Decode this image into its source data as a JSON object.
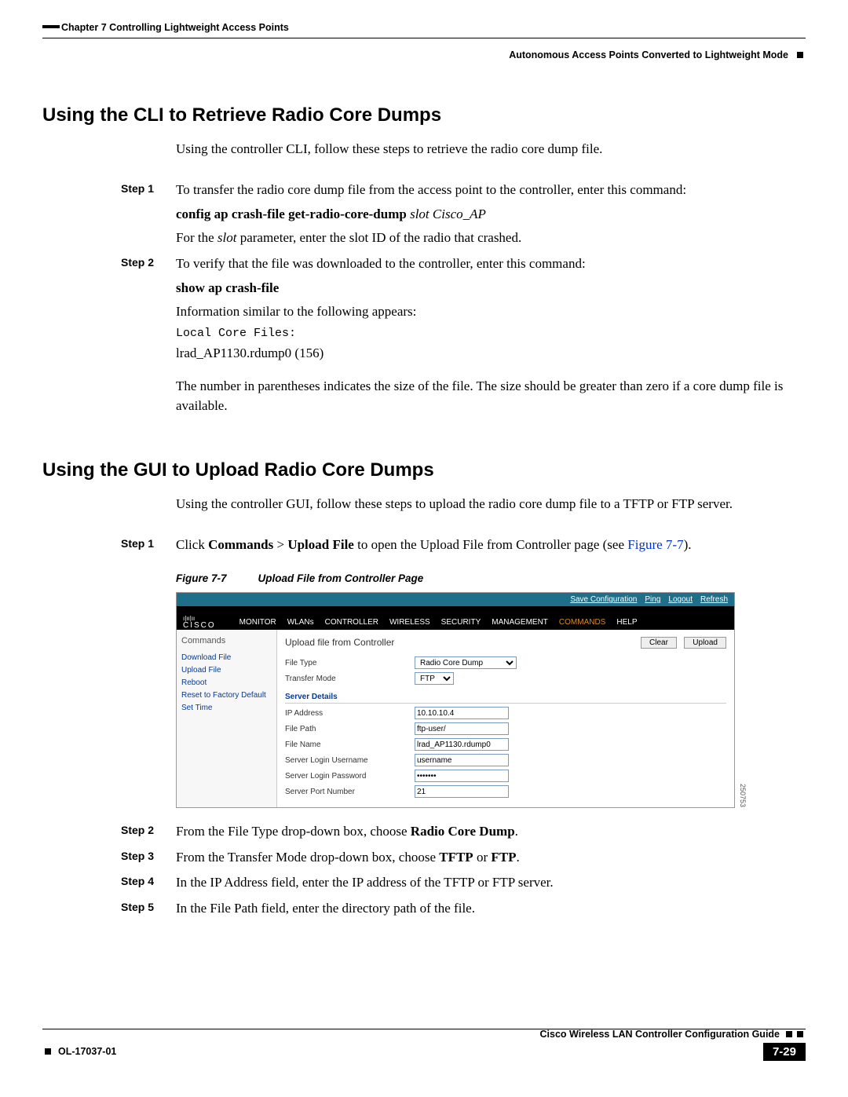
{
  "header": {
    "chapter_left": "Chapter 7    Controlling Lightweight Access Points",
    "right_sub": "Autonomous Access Points Converted to Lightweight Mode"
  },
  "section1": {
    "title": "Using the CLI to Retrieve Radio Core Dumps",
    "intro": "Using the controller CLI, follow these steps to retrieve the radio core dump file.",
    "step1_label": "Step 1",
    "step1_text": "To transfer the radio core dump file from the access point to the controller, enter this command:",
    "step1_cmd_bold": "config ap crash-file get-radio-core-dump ",
    "step1_cmd_ital": "slot Cisco_AP",
    "step1_text2a": "For the ",
    "step1_text2_ital": "slot",
    "step1_text2b": " parameter, enter the slot ID of the radio that crashed.",
    "step2_label": "Step 2",
    "step2_text": "To verify that the file was downloaded to the controller, enter this command:",
    "step2_cmd": "show ap crash-file",
    "step2_info": "Information similar to the following appears:",
    "step2_mono": "Local Core Files:",
    "step2_line": "lrad_AP1130.rdump0   (156)",
    "step2_note": "The number in parentheses indicates the size of the file. The size should be greater than zero if a core dump file is available."
  },
  "section2": {
    "title": "Using the GUI to Upload Radio Core Dumps",
    "intro": "Using the controller GUI, follow these steps to upload the radio core dump file to a TFTP or FTP server.",
    "step1_label": "Step 1",
    "step1_a": "Click ",
    "step1_b": "Commands",
    "step1_c": " > ",
    "step1_d": "Upload File",
    "step1_e": " to open the Upload File from Controller page (see ",
    "step1_link": "Figure 7-7",
    "step1_f": ").",
    "fig_num": "Figure 7-7",
    "fig_title": "Upload File from Controller Page",
    "step2_label": "Step 2",
    "step2_a": "From the File Type drop-down box, choose ",
    "step2_b": "Radio Core Dump",
    "step2_c": ".",
    "step3_label": "Step 3",
    "step3_a": "From the Transfer Mode drop-down box, choose ",
    "step3_b": "TFTP",
    "step3_c": " or ",
    "step3_d": "FTP",
    "step3_e": ".",
    "step4_label": "Step 4",
    "step4_text": "In the IP Address field, enter the IP address of the TFTP or FTP server.",
    "step5_label": "Step 5",
    "step5_text": "In the File Path field, enter the directory path of the file."
  },
  "screenshot": {
    "toplinks": [
      "Save Configuration",
      "Ping",
      "Logout",
      "Refresh"
    ],
    "logo": "CISCO",
    "nav": [
      "MONITOR",
      "WLANs",
      "CONTROLLER",
      "WIRELESS",
      "SECURITY",
      "MANAGEMENT",
      "COMMANDS",
      "HELP"
    ],
    "nav_active_index": 6,
    "side_title": "Commands",
    "side_links": [
      "Download File",
      "Upload File",
      "Reboot",
      "Reset to Factory Default",
      "Set Time"
    ],
    "main_title": "Upload file from Controller",
    "btn_clear": "Clear",
    "btn_upload": "Upload",
    "file_type_label": "File Type",
    "file_type_value": "Radio Core Dump",
    "transfer_mode_label": "Transfer Mode",
    "transfer_mode_value": "FTP",
    "server_details": "Server Details",
    "ip_label": "IP Address",
    "ip_value": "10.10.10.4",
    "path_label": "File Path",
    "path_value": "ftp-user/",
    "name_label": "File Name",
    "name_value": "lrad_AP1130.rdump0",
    "user_label": "Server Login Username",
    "user_value": "username",
    "pass_label": "Server Login Password",
    "pass_value": "•••••••",
    "port_label": "Server Port Number",
    "port_value": "21",
    "sideno": "250753"
  },
  "footer": {
    "guide": "Cisco Wireless LAN Controller Configuration Guide",
    "docid": "OL-17037-01",
    "page": "7-29"
  }
}
